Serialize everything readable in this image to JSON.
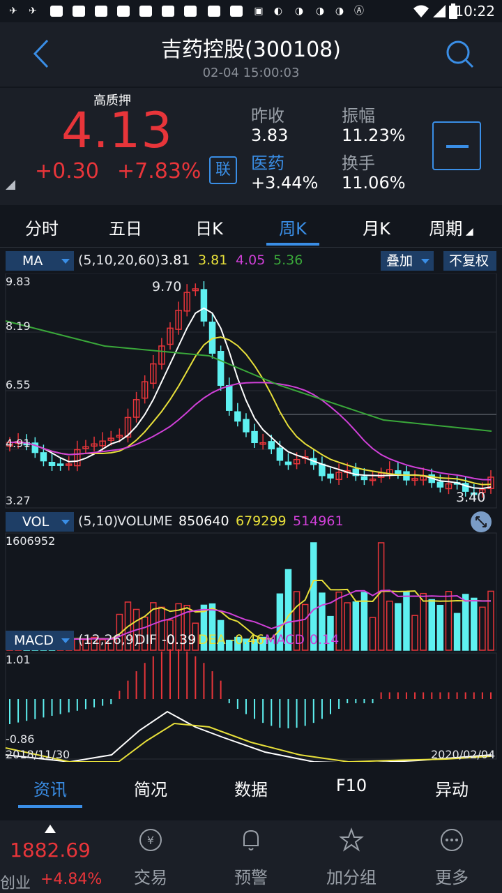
{
  "status_bar": {
    "time": "10:22"
  },
  "header": {
    "title": "吉药控股(300108)",
    "timestamp": "02-04 15:00:03"
  },
  "quote": {
    "badge": "高质押",
    "price": "4.13",
    "change": "+0.30",
    "change_pct": "+7.83%",
    "lian_label": "联",
    "prev_close_label": "昨收",
    "prev_close": "3.83",
    "sector_label": "医药",
    "sector_change": "+3.44%",
    "amplitude_label": "振幅",
    "amplitude": "11.23%",
    "turnover_label": "换手",
    "turnover": "11.06%"
  },
  "tabs": [
    "分时",
    "五日",
    "日K",
    "周K",
    "月K",
    "周期"
  ],
  "active_tab": "周K",
  "ma": {
    "selector": "MA",
    "params": "(5,10,20,60)",
    "v5": "3.81",
    "v10": "3.81",
    "v20": "4.05",
    "v60": "5.36",
    "overlay": "叠加",
    "adjust": "不复权"
  },
  "price_axis": {
    "top": "9.83",
    "l2": "8.19",
    "l3": "6.55",
    "l4": "4.91",
    "bottom": "3.27"
  },
  "high_marker": "9.70",
  "low_marker": "3.40",
  "vol": {
    "selector": "VOL",
    "params": "(5,10)",
    "label": "VOLUME",
    "v": "850640",
    "v5": "679299",
    "v10": "514961",
    "max": "1606952"
  },
  "macd": {
    "selector": "MACD",
    "params": "(12,26,9)",
    "dif_label": "DIF",
    "dif": "-0.39",
    "dea_label": "DEA",
    "dea": "-0.46",
    "macd_label": "MACD",
    "macd": "0.14",
    "max": "1.01",
    "min": "-0.86"
  },
  "date_range": {
    "start": "2018/11/30",
    "end": "2020/02/04"
  },
  "colors": {
    "up": "#e8353a",
    "down": "#5ef0f0",
    "ma5": "#ffffff",
    "ma10": "#e8e03a",
    "ma20": "#d040d8",
    "ma60": "#3aa83a",
    "accent": "#3a8ee6"
  },
  "bottom_tabs": [
    "资讯",
    "简况",
    "数据",
    "F10",
    "异动"
  ],
  "active_bottom_tab": "资讯",
  "nav": {
    "index_value": "1882.69",
    "index_name": "创业",
    "index_change": "+4.84%",
    "items": [
      "交易",
      "预警",
      "加分组",
      "更多"
    ]
  }
}
